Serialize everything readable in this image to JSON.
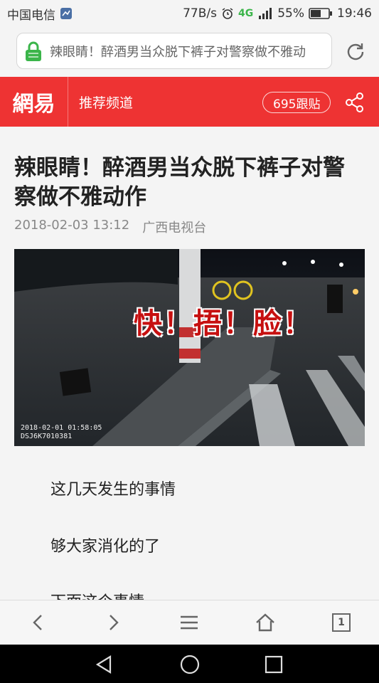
{
  "status_bar": {
    "carrier": "中国电信",
    "net_speed": "77B/s",
    "network_type": "4G",
    "battery": "55%",
    "time": "19:46"
  },
  "address_bar": {
    "url_text": "辣眼睛！醉酒男当众脱下裤子对警察做不雅动",
    "secure_color": "#3bb54a"
  },
  "site_header": {
    "logo_text": "網易",
    "channel_label": "推荐频道",
    "comments_label": "695跟贴",
    "brand_color": "#ee3333"
  },
  "article": {
    "headline": "辣眼睛！醉酒男当众脱下裤子对警察做不雅动作",
    "date": "2018-02-03 13:12",
    "source": "广西电视台",
    "photo": {
      "overlay_text": "快！捂！脸！",
      "stamp_line1": "2018-02-01 01:58:05",
      "stamp_line2": "DSJ6K7010381"
    },
    "paragraphs": [
      "这几天发生的事情",
      "够大家消化的了",
      "下面这个事情"
    ]
  },
  "toolbar": {
    "tabs_count": "1",
    "icons": [
      "back-icon",
      "forward-icon",
      "menu-icon",
      "home-icon",
      "tabs-icon"
    ]
  },
  "navbar": {
    "icons": [
      "nav-back-icon",
      "nav-home-icon",
      "nav-recents-icon"
    ]
  }
}
